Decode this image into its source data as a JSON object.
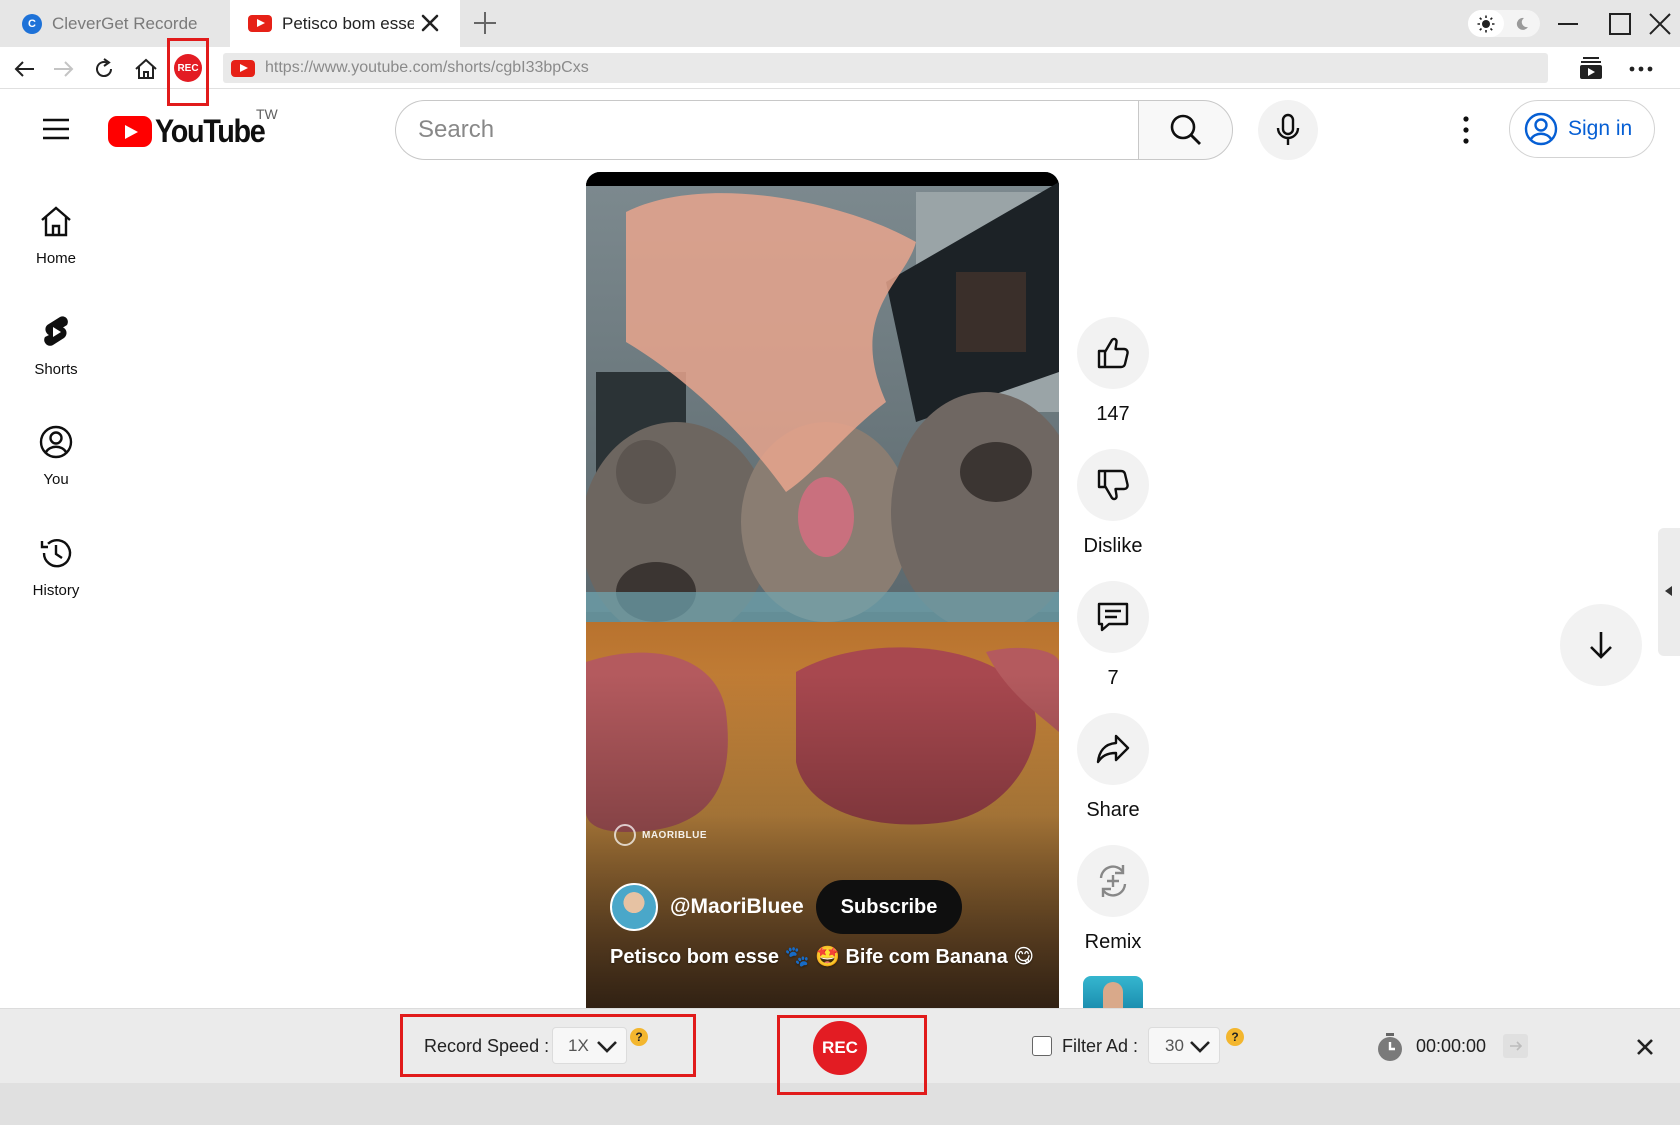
{
  "browser": {
    "tabs": [
      {
        "label": "CleverGet Recorde",
        "icon": "cleverget-icon",
        "active": false
      },
      {
        "label": "Petisco bom esse 🐾🤩 Bife com Banana",
        "icon": "youtube-icon",
        "active": true
      }
    ],
    "cleverget_icon_text": "C",
    "rec_button_label": "REC",
    "url": "https://www.youtube.com/shorts/cgbI33bpCxs"
  },
  "youtube": {
    "logo_text": "YouTube",
    "region": "TW",
    "search_placeholder": "Search",
    "sign_in_label": "Sign in",
    "nav": [
      {
        "label": "Home",
        "icon": "home-icon"
      },
      {
        "label": "Shorts",
        "icon": "shorts-icon"
      },
      {
        "label": "You",
        "icon": "you-icon"
      },
      {
        "label": "History",
        "icon": "history-icon"
      }
    ],
    "short": {
      "watermark": "MAORIBLUE",
      "channel": "@MaoriBluee",
      "subscribe_label": "Subscribe",
      "caption": "Petisco bom esse 🐾 🤩 Bife com Banana 😋"
    },
    "actions": {
      "like_count": "147",
      "dislike_label": "Dislike",
      "comment_count": "7",
      "share_label": "Share",
      "remix_label": "Remix"
    }
  },
  "recorder": {
    "record_speed_label": "Record Speed :",
    "record_speed_value": "1X",
    "help_mark": "?",
    "rec_label": "REC",
    "filter_ad_label": "Filter Ad :",
    "filter_ad_value": "30",
    "filter_ad_checked": false,
    "timer": "00:00:00"
  },
  "colors": {
    "rec_red": "#e31c23",
    "youtube_red": "#ff0000",
    "link_blue": "#065fd4",
    "highlight_box": "#e11b1b"
  }
}
